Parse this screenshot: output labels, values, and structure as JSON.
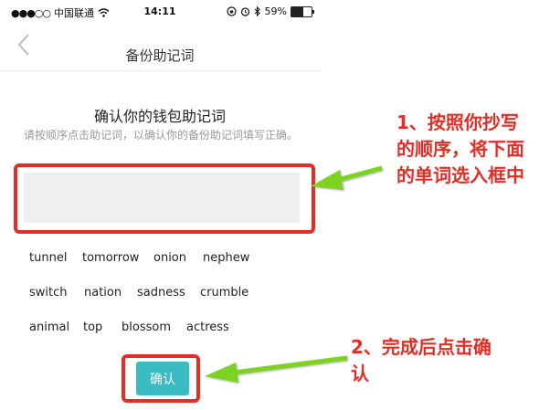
{
  "status_bar": {
    "signal_dots": "●●●○○",
    "carrier": "中国联通",
    "time": "14:11",
    "battery": "59%",
    "battery_level": 0.59,
    "icons": [
      "wifi-icon",
      "lock-rotation-icon",
      "alarm-icon",
      "bluetooth-icon",
      "battery-icon"
    ]
  },
  "nav": {
    "title": "备份助记词",
    "back_icon": "chevron-left-icon"
  },
  "main": {
    "heading": "确认你的钱包助记词",
    "hint": "请按顺序点击助记词，以确认你的备份助记词填写正确。",
    "phrase_value": "",
    "words": [
      "tunnel",
      "tomorrow",
      "onion",
      "nephew",
      "switch",
      "nation",
      "sadness",
      "crumble",
      "animal",
      "top",
      "blossom",
      "actress"
    ],
    "confirm_label": "确认"
  },
  "annotations": {
    "note1": "1、按照你抄写的顺序，将下面的单词选入框中",
    "note2": "2、完成后点击确认"
  },
  "colors": {
    "accent": "#3bbcc4",
    "annotation_red": "#e52d26",
    "arrow_green": "#7ed321",
    "phrase_box": "#efeef0"
  }
}
